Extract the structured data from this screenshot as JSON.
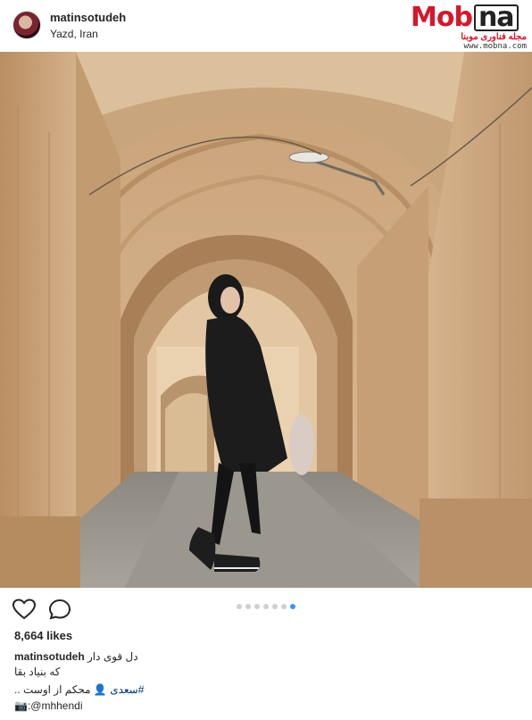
{
  "post": {
    "username": "matinsotudeh",
    "location": "Yazd, Iran",
    "likes": "8,664 likes",
    "carousel": {
      "total": 7,
      "active_index": 6
    }
  },
  "caption": {
    "username": "matinsotudeh",
    "line1": "دل قوی دار",
    "line2": "که بنیاد بقا",
    "line3_text": "محکم از اوست ..",
    "line3_hashtag": "#سعدی",
    "line3_emoji": "👤",
    "line4_prefix": "📷:",
    "line4_mention": "@mhhendi"
  },
  "watermark": {
    "brand_mob": "Mob",
    "brand_na": "na",
    "subtitle": "مجله فناوری موبنا",
    "url": "www.mobna.com"
  },
  "icons": {
    "like": "heart-icon",
    "comment": "comment-bubble-icon"
  },
  "colors": {
    "accent": "#3897f0",
    "brand": "#d5182b",
    "text": "#262626",
    "wall": "#c9a57d"
  }
}
